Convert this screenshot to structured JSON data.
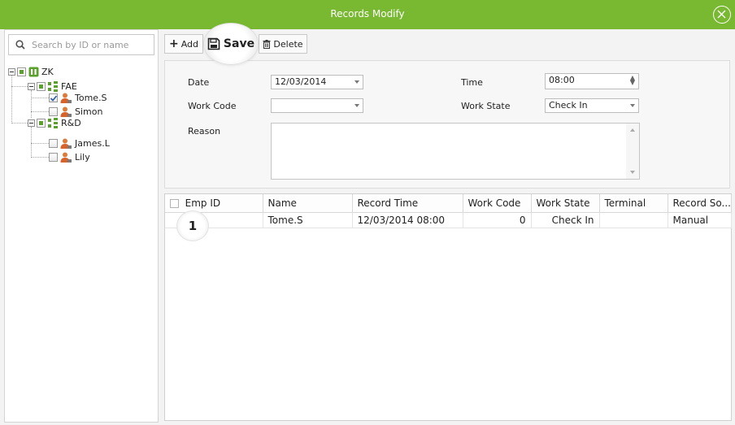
{
  "window": {
    "title": "Records Modify"
  },
  "search": {
    "placeholder": "Search by ID or name"
  },
  "tree": {
    "root": "ZK",
    "groups": [
      {
        "label": "FAE",
        "members": [
          {
            "label": "Tome.S",
            "checked": true
          },
          {
            "label": "Simon",
            "checked": false
          }
        ]
      },
      {
        "label": "R&D",
        "members": [
          {
            "label": "James.L",
            "checked": false
          },
          {
            "label": "Lily",
            "checked": false
          }
        ]
      }
    ]
  },
  "toolbar": {
    "add_label": "Add",
    "save_label": "Save",
    "delete_label": "Delete"
  },
  "form": {
    "date_label": "Date",
    "date_value": "12/03/2014",
    "time_label": "Time",
    "time_value": "08:00",
    "workcode_label": "Work Code",
    "workcode_value": "",
    "workstate_label": "Work State",
    "workstate_value": "Check In",
    "reason_label": "Reason",
    "reason_value": ""
  },
  "table": {
    "columns": [
      "Emp ID",
      "Name",
      "Record Time",
      "Work Code",
      "Work State",
      "Terminal",
      "Record So..."
    ],
    "rows": [
      {
        "emp_id": "1",
        "name": "Tome.S",
        "record_time": "12/03/2014 08:00",
        "work_code": "0",
        "work_state": "Check In",
        "terminal": "",
        "record_source": "Manual"
      }
    ]
  },
  "colors": {
    "titlebar": "#79b931",
    "accent_icon": "#5aa02c",
    "user_icon": "#d9622b"
  }
}
